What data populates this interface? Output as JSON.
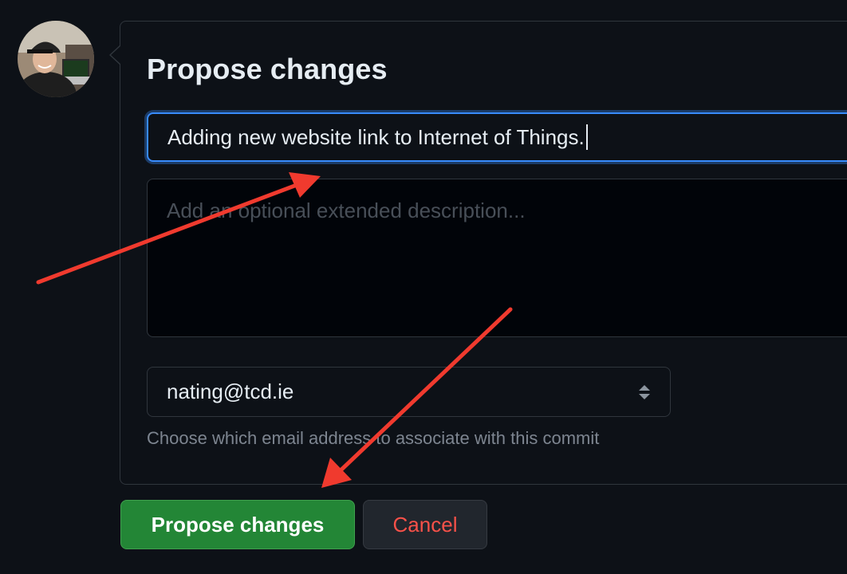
{
  "form": {
    "title": "Propose changes",
    "summary_value": "Adding new website link to Internet of Things.",
    "description_placeholder": "Add an optional extended description...",
    "email_selected": "nating@tcd.ie",
    "email_hint": "Choose which email address to associate with this commit"
  },
  "buttons": {
    "propose_label": "Propose changes",
    "cancel_label": "Cancel"
  },
  "colors": {
    "background": "#0d1117",
    "accent_focus": "#388bfd",
    "primary_button": "#238636",
    "danger_text": "#f85149",
    "annotation_arrow": "#f03a2e"
  },
  "icons": {
    "select_arrows": "select-updown-icon",
    "avatar": "user-avatar"
  }
}
